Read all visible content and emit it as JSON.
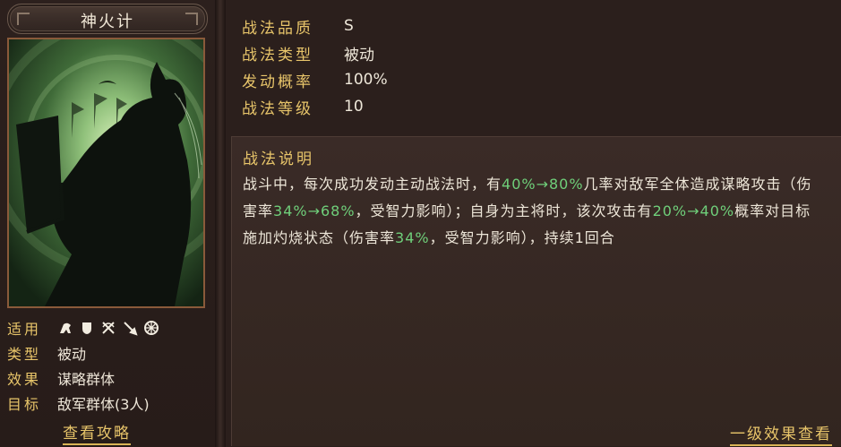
{
  "skill": {
    "name": "神火计"
  },
  "attributes": {
    "suitable_label": "适用",
    "suitable_icons": [
      "cavalry-icon",
      "shield-icon",
      "bow-icon",
      "spear-icon",
      "wheel-icon"
    ],
    "type_label": "类型",
    "type_value": "被动",
    "effect_label": "效果",
    "effect_value": "谋略群体",
    "target_label": "目标",
    "target_value": "敌军群体(3人)"
  },
  "links": {
    "guide": "查看攻略",
    "level_effect": "一级效果查看"
  },
  "stats": [
    {
      "label": "战法品质",
      "value": "S"
    },
    {
      "label": "战法类型",
      "value": "被动"
    },
    {
      "label": "发动概率",
      "value": "100%"
    },
    {
      "label": "战法等级",
      "value": "10"
    }
  ],
  "description": {
    "title": "战法说明",
    "t1": "战斗中，每次成功发动主动战法时，有",
    "h1": "40%→80%",
    "t2": "几率对敌军全体造成谋略攻击（伤害率",
    "h2": "34%→68%",
    "t3": "，受智力影响）；自身为主将时，该次攻击有",
    "h3": "20%→40%",
    "t4": "概率对目标施加灼烧状态（伤害率",
    "h4": "34%",
    "t5": "，受智力影响），持续1回合"
  },
  "colors": {
    "label_gold": "#e8c56a",
    "highlight_green": "#6fcf7a",
    "text": "#ede6d8"
  }
}
